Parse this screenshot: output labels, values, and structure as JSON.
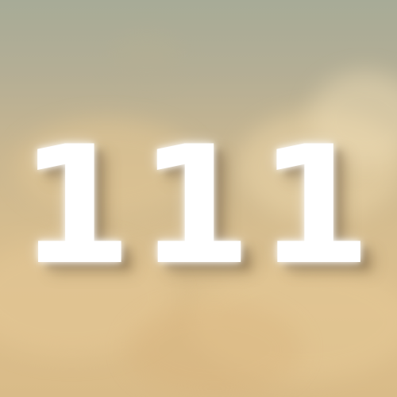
{
  "image": {
    "number_text": "111",
    "colors": {
      "sky_top": "#a7ab97",
      "sky_mid": "#c9b690",
      "sky_bottom": "#d9bb88",
      "numeral": "#ffffff"
    }
  }
}
